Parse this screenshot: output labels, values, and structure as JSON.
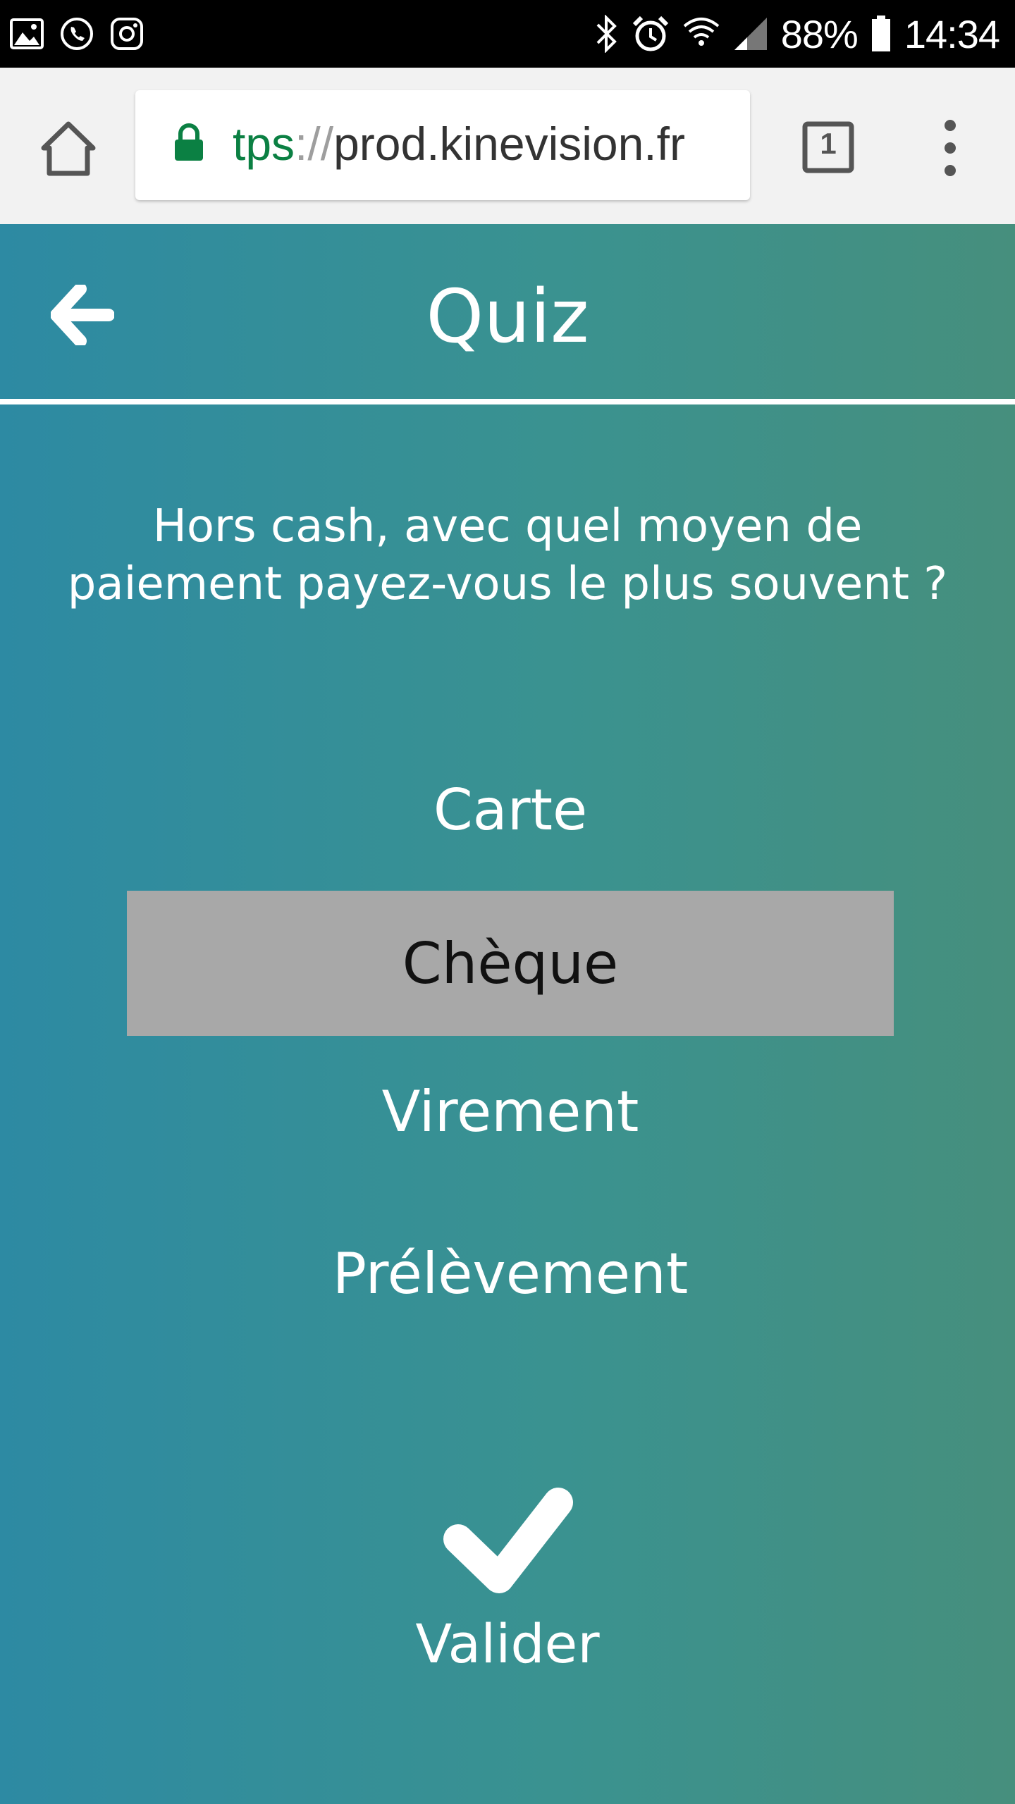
{
  "status_bar": {
    "icons_left": [
      "gallery-icon",
      "whatsapp-icon",
      "instagram-icon"
    ],
    "icons_right": [
      "bluetooth-icon",
      "alarm-icon",
      "wifi-icon",
      "signal-icon",
      "battery-icon"
    ],
    "battery_percent": "88%",
    "time": "14:34"
  },
  "browser": {
    "url_scheme": "tps",
    "url_separator": "://",
    "url_host": "prod.kinevision.fr",
    "tab_count": "1"
  },
  "app": {
    "title": "Quiz",
    "question": "Hors cash, avec quel moyen de paiement payez-vous le plus souvent ?",
    "options": [
      {
        "label": "Carte",
        "selected": false
      },
      {
        "label": "Chèque",
        "selected": true
      },
      {
        "label": "Virement",
        "selected": false
      },
      {
        "label": "Prélèvement",
        "selected": false
      }
    ],
    "validate_label": "Valider"
  },
  "colors": {
    "background_start": "#2d8aa3",
    "background_end": "#468f7d",
    "selected_option": "#a8a8a8",
    "lock_green": "#0b8043"
  }
}
